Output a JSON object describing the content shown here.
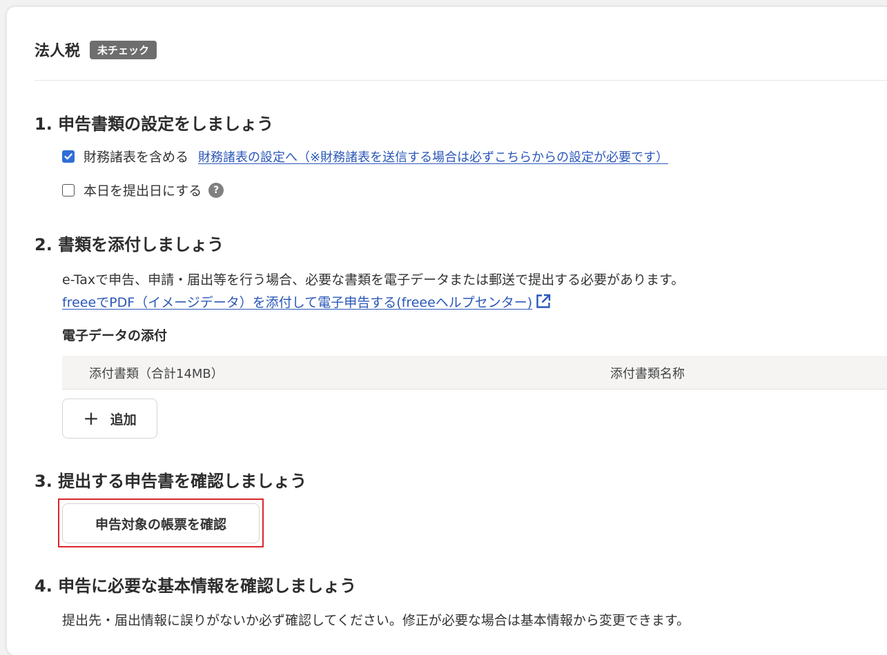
{
  "header": {
    "title": "法人税",
    "status_badge": "未チェック"
  },
  "section1": {
    "title": "1. 申告書類の設定をしましょう",
    "include_financials": {
      "label": "財務諸表を含める",
      "checked": true,
      "link_text": "財務諸表の設定へ（※財務諸表を送信する場合は必ずこちらからの設定が必要です）"
    },
    "submit_today": {
      "label": "本日を提出日にする",
      "checked": false,
      "help_glyph": "?"
    }
  },
  "section2": {
    "title": "2. 書類を添付しましょう",
    "description": "e-Taxで申告、申請・届出等を行う場合、必要な書類を電子データまたは郵送で提出する必要があります。",
    "help_link_text": "freeeでPDF（イメージデータ）を添付して電子申告する(freeeヘルプセンター)",
    "attachments_title": "電子データの添付",
    "table": {
      "columns": [
        "添付書類（合計14MB）",
        "添付書類名称"
      ],
      "rows": []
    },
    "add_button_icon": "+",
    "add_button_label": "追加"
  },
  "section3": {
    "title": "3. 提出する申告書を確認しましょう",
    "confirm_button_label": "申告対象の帳票を確認"
  },
  "section4": {
    "title": "4. 申告に必要な基本情報を確認しましょう",
    "description": "提出先・届出情報に誤りがないか必ず確認してください。修正が必要な場合は基本情報から変更できます。"
  },
  "colors": {
    "accent_blue": "#2f6fd6",
    "link": "#2a57b8",
    "badge_bg": "#6e6e6e",
    "highlight_red": "#d9262b"
  }
}
